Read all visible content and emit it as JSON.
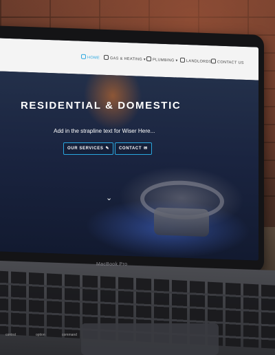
{
  "nav": {
    "items": [
      {
        "label": "HOME",
        "icon": "home-icon",
        "active": true
      },
      {
        "label": "GAS & HEATING",
        "icon": "gas-icon",
        "dropdown": true
      },
      {
        "label": "PLUMBING",
        "icon": "drop-icon",
        "dropdown": true
      },
      {
        "label": "LANDLORDS",
        "icon": "building-icon"
      },
      {
        "label": "CONTACT US",
        "icon": "mail-icon"
      }
    ]
  },
  "hero": {
    "title": "RESIDENTIAL & DOMESTIC",
    "strapline": "Add in the strapline text for Wiser Here...",
    "buttons": [
      {
        "label": "OUR SERVICES",
        "icon": "wrench-icon"
      },
      {
        "label": "CONTACT",
        "icon": "mail-icon"
      }
    ],
    "scroll_glyph": "⌄"
  },
  "device": {
    "brand_label": "MacBook Pro"
  },
  "keyboard": {
    "labels": [
      "control",
      "option",
      "command"
    ]
  },
  "colors": {
    "accent": "#2aa8e0",
    "navbar_bg": "#f4f4f4",
    "hero_text": "#ffffff"
  }
}
